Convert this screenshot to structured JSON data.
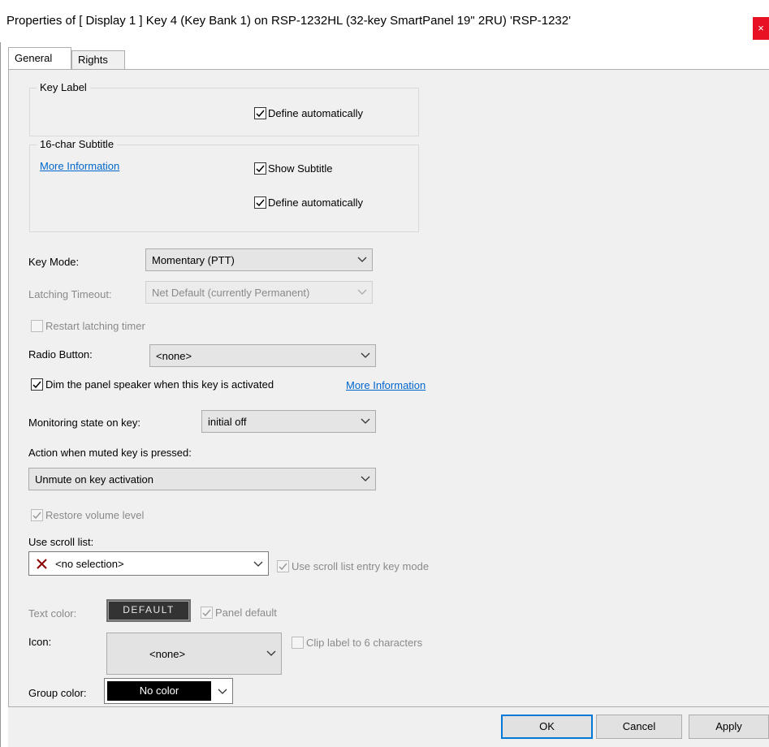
{
  "window": {
    "title": "Properties of [ Display 1 ] Key 4 (Key Bank 1) on RSP-1232HL (32-key SmartPanel 19\" 2RU) 'RSP-1232'",
    "close_glyph": "×"
  },
  "tabs": [
    {
      "label": "General",
      "active": true
    },
    {
      "label": "Rights",
      "active": false
    }
  ],
  "key_label_group": {
    "title": "Key Label",
    "define_automatically": {
      "label": "Define automatically",
      "checked": true
    }
  },
  "subtitle_group": {
    "title": "16-char Subtitle",
    "more_info": "More Information",
    "show_subtitle": {
      "label": "Show Subtitle",
      "checked": true
    },
    "define_automatically": {
      "label": "Define automatically",
      "checked": true
    }
  },
  "key_mode": {
    "label": "Key Mode:",
    "value": "Momentary (PTT)"
  },
  "latching_timeout": {
    "label": "Latching Timeout:",
    "value": "Net Default (currently Permanent)",
    "enabled": false
  },
  "restart_latching": {
    "label": "Restart latching timer",
    "checked": false,
    "enabled": false
  },
  "radio_button": {
    "label": "Radio Button:",
    "value": "<none>"
  },
  "dim_speaker": {
    "label": "Dim the panel speaker when this key is activated",
    "checked": true,
    "more_info": "More Information"
  },
  "monitoring": {
    "label": "Monitoring state on key:",
    "value": "initial off"
  },
  "muted_action": {
    "label": "Action when muted key is pressed:",
    "value": "Unmute on key activation"
  },
  "restore_volume": {
    "label": "Restore volume level",
    "checked": true,
    "enabled": false
  },
  "scroll_list": {
    "label": "Use scroll list:",
    "value": "<no selection>",
    "entry_key_mode": {
      "label": "Use scroll list entry key mode",
      "checked": true,
      "enabled": false
    }
  },
  "text_color": {
    "label": "Text color:",
    "button": "DEFAULT",
    "panel_default": {
      "label": "Panel default",
      "checked": true,
      "enabled": false
    }
  },
  "icon": {
    "label": "Icon:",
    "value": "<none>",
    "clip_label": {
      "label": "Clip label to 6 characters",
      "checked": false,
      "enabled": false
    }
  },
  "group_color": {
    "label": "Group color:",
    "value": "No color"
  },
  "buttons": {
    "ok": "OK",
    "cancel": "Cancel",
    "apply": "Apply"
  },
  "colors": {
    "accent": "#0078d7",
    "link": "#0066cc",
    "close": "#e81123",
    "error_x": "#8b0000"
  }
}
